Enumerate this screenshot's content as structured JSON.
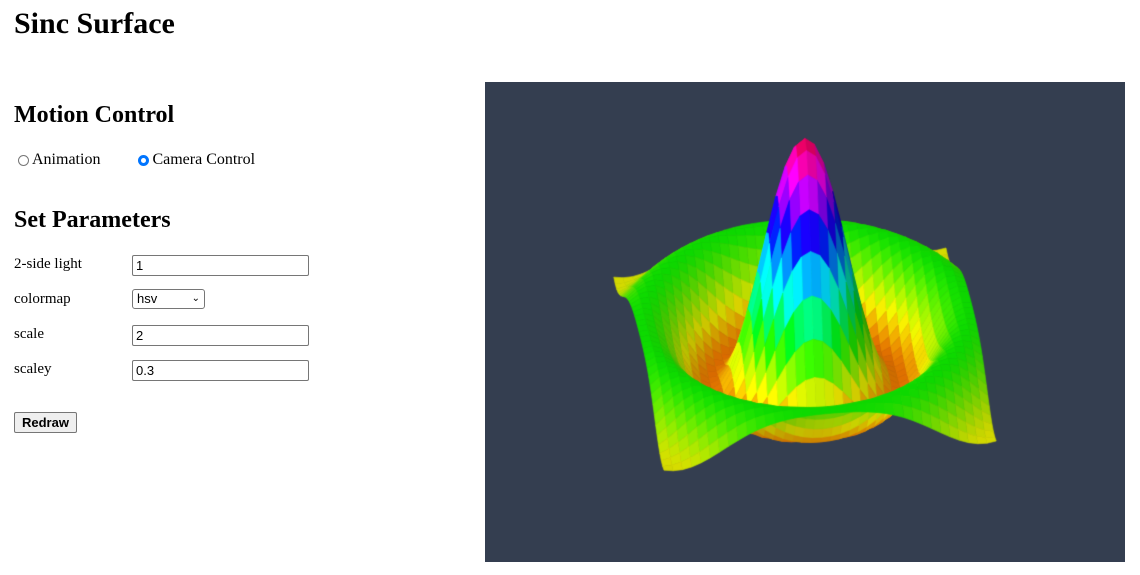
{
  "page": {
    "title": "Sinc Surface"
  },
  "motion_control": {
    "title": "Motion Control",
    "options": [
      {
        "label": "Animation",
        "checked": false
      },
      {
        "label": "Camera Control",
        "checked": true
      }
    ]
  },
  "parameters": {
    "title": "Set Parameters",
    "two_side_light": {
      "label": "2-side light",
      "value": "1"
    },
    "colormap": {
      "label": "colormap",
      "value": "hsv"
    },
    "scale": {
      "label": "scale",
      "value": "2"
    },
    "scaley": {
      "label": "scaley",
      "value": "0.3"
    },
    "redraw_label": "Redraw"
  },
  "viewport": {
    "background": "#343e50",
    "surface": "sinc",
    "colormap": "hsv"
  },
  "icons": {
    "select_chevron": "chevron-down-icon"
  }
}
